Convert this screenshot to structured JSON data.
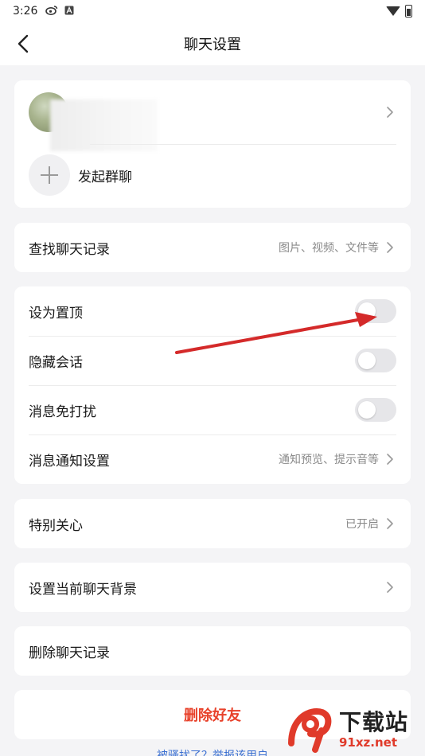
{
  "status_bar": {
    "time": "3:26",
    "icons": [
      "weibo-icon",
      "a-icon"
    ]
  },
  "header": {
    "title": "聊天设置"
  },
  "profile": {
    "group_chat_label": "发起群聊"
  },
  "search_card": {
    "label": "查找聊天记录",
    "value": "图片、视频、文件等"
  },
  "settings_card": {
    "pin_label": "设为置顶",
    "pin_on": false,
    "hide_label": "隐藏会话",
    "hide_on": false,
    "mute_label": "消息免打扰",
    "mute_on": false,
    "notify_label": "消息通知设置",
    "notify_value": "通知预览、提示音等"
  },
  "special_card": {
    "label": "特别关心",
    "value": "已开启"
  },
  "background_card": {
    "label": "设置当前聊天背景"
  },
  "delete_history_card": {
    "label": "删除聊天记录"
  },
  "delete_friend_card": {
    "label": "删除好友"
  },
  "report": {
    "text": "被骚扰了？举报该用户"
  },
  "watermark": {
    "big": "下载站",
    "small": "91xz.net"
  },
  "colors": {
    "background": "#f4f4f6",
    "card": "#ffffff",
    "danger": "#e8412a",
    "link": "#3a6fd1",
    "annotation_arrow": "#d42a2a"
  }
}
